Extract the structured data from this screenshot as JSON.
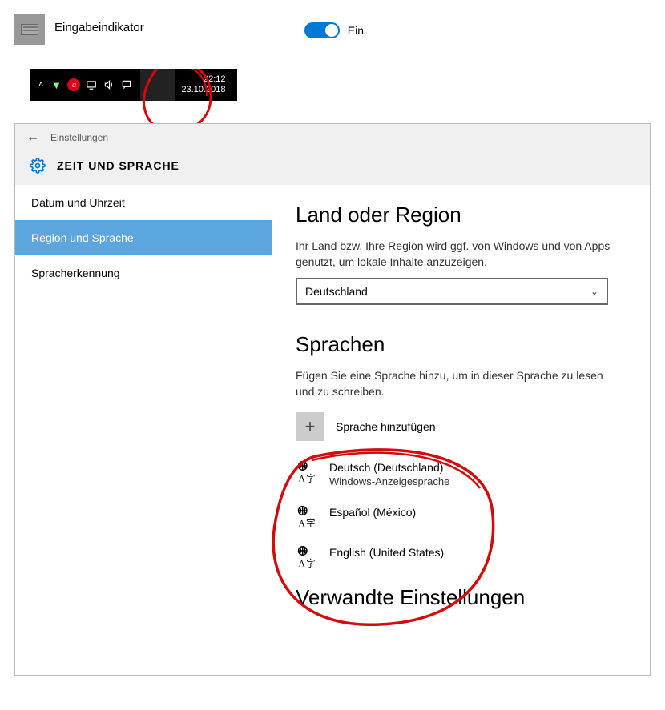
{
  "top": {
    "input_indicator": "Eingabeindikator",
    "toggle_state_label": "Ein",
    "toggle_on": true
  },
  "taskbar": {
    "time": "22:12",
    "date": "23.10.2018"
  },
  "settings": {
    "app_title": "Einstellungen",
    "section_header": "ZEIT UND SPRACHE",
    "nav": {
      "items": [
        {
          "label": "Datum und Uhrzeit",
          "selected": false
        },
        {
          "label": "Region und Sprache",
          "selected": true
        },
        {
          "label": "Spracherkennung",
          "selected": false
        }
      ]
    },
    "region": {
      "title": "Land oder Region",
      "description": "Ihr Land bzw. Ihre Region wird ggf. von Windows und von Apps genutzt, um lokale Inhalte anzuzeigen.",
      "selected_country": "Deutschland"
    },
    "languages": {
      "title": "Sprachen",
      "description": "Fügen Sie eine Sprache hinzu, um in dieser Sprache zu lesen und zu schreiben.",
      "add_label": "Sprache hinzufügen",
      "items": [
        {
          "name": "Deutsch (Deutschland)",
          "sub": "Windows-Anzeigesprache"
        },
        {
          "name": "Español (México)",
          "sub": ""
        },
        {
          "name": "English (United States)",
          "sub": ""
        }
      ]
    },
    "related_title": "Verwandte Einstellungen"
  }
}
